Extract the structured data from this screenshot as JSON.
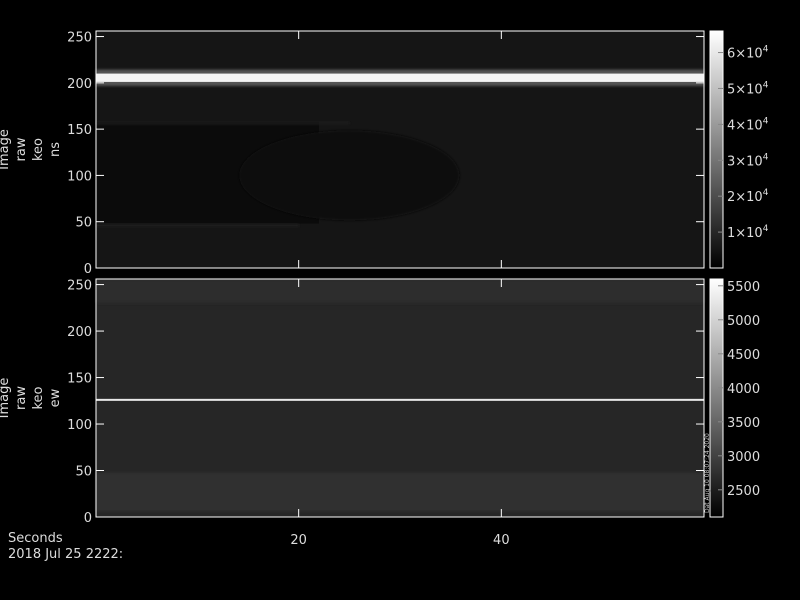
{
  "chart_data": [
    {
      "type": "heatmap",
      "ylabel_lines": [
        "Image",
        "raw",
        "keo",
        "ns"
      ],
      "ylim": [
        0,
        256
      ],
      "yticks": [
        0,
        50,
        100,
        150,
        200,
        250
      ],
      "xlim": [
        0,
        60
      ],
      "xticks": [
        20,
        40
      ],
      "colorbar": {
        "ticks": [
          {
            "base": "1×10",
            "exp": "4",
            "value": 10000
          },
          {
            "base": "2×10",
            "exp": "4",
            "value": 20000
          },
          {
            "base": "3×10",
            "exp": "4",
            "value": 30000
          },
          {
            "base": "4×10",
            "exp": "4",
            "value": 40000
          },
          {
            "base": "5×10",
            "exp": "4",
            "value": 50000
          },
          {
            "base": "6×10",
            "exp": "4",
            "value": 60000
          }
        ],
        "range": [
          0,
          66000
        ]
      },
      "bright_band_y": [
        201,
        210
      ],
      "background": "#151515"
    },
    {
      "type": "heatmap",
      "ylabel_lines": [
        "Image",
        "raw",
        "keo",
        "ew"
      ],
      "ylim": [
        0,
        256
      ],
      "yticks": [
        0,
        50,
        100,
        150,
        200,
        250
      ],
      "xlim": [
        0,
        60
      ],
      "xticks": [
        20,
        40
      ],
      "colorbar": {
        "ticks": [
          {
            "label": "2500",
            "value": 2500
          },
          {
            "label": "3000",
            "value": 3000
          },
          {
            "label": "3500",
            "value": 3500
          },
          {
            "label": "4000",
            "value": 4000
          },
          {
            "label": "4500",
            "value": 4500
          },
          {
            "label": "5000",
            "value": 5000
          },
          {
            "label": "5500",
            "value": 5500
          }
        ],
        "range": [
          2100,
          5600
        ],
        "side_note": "Dat Aug 10 08:07:24 2020"
      },
      "bright_line_y": 126,
      "background": "#262626"
    }
  ],
  "footer": {
    "xlabel": "Seconds",
    "date_line": "2018 Jul 25 2222:"
  }
}
